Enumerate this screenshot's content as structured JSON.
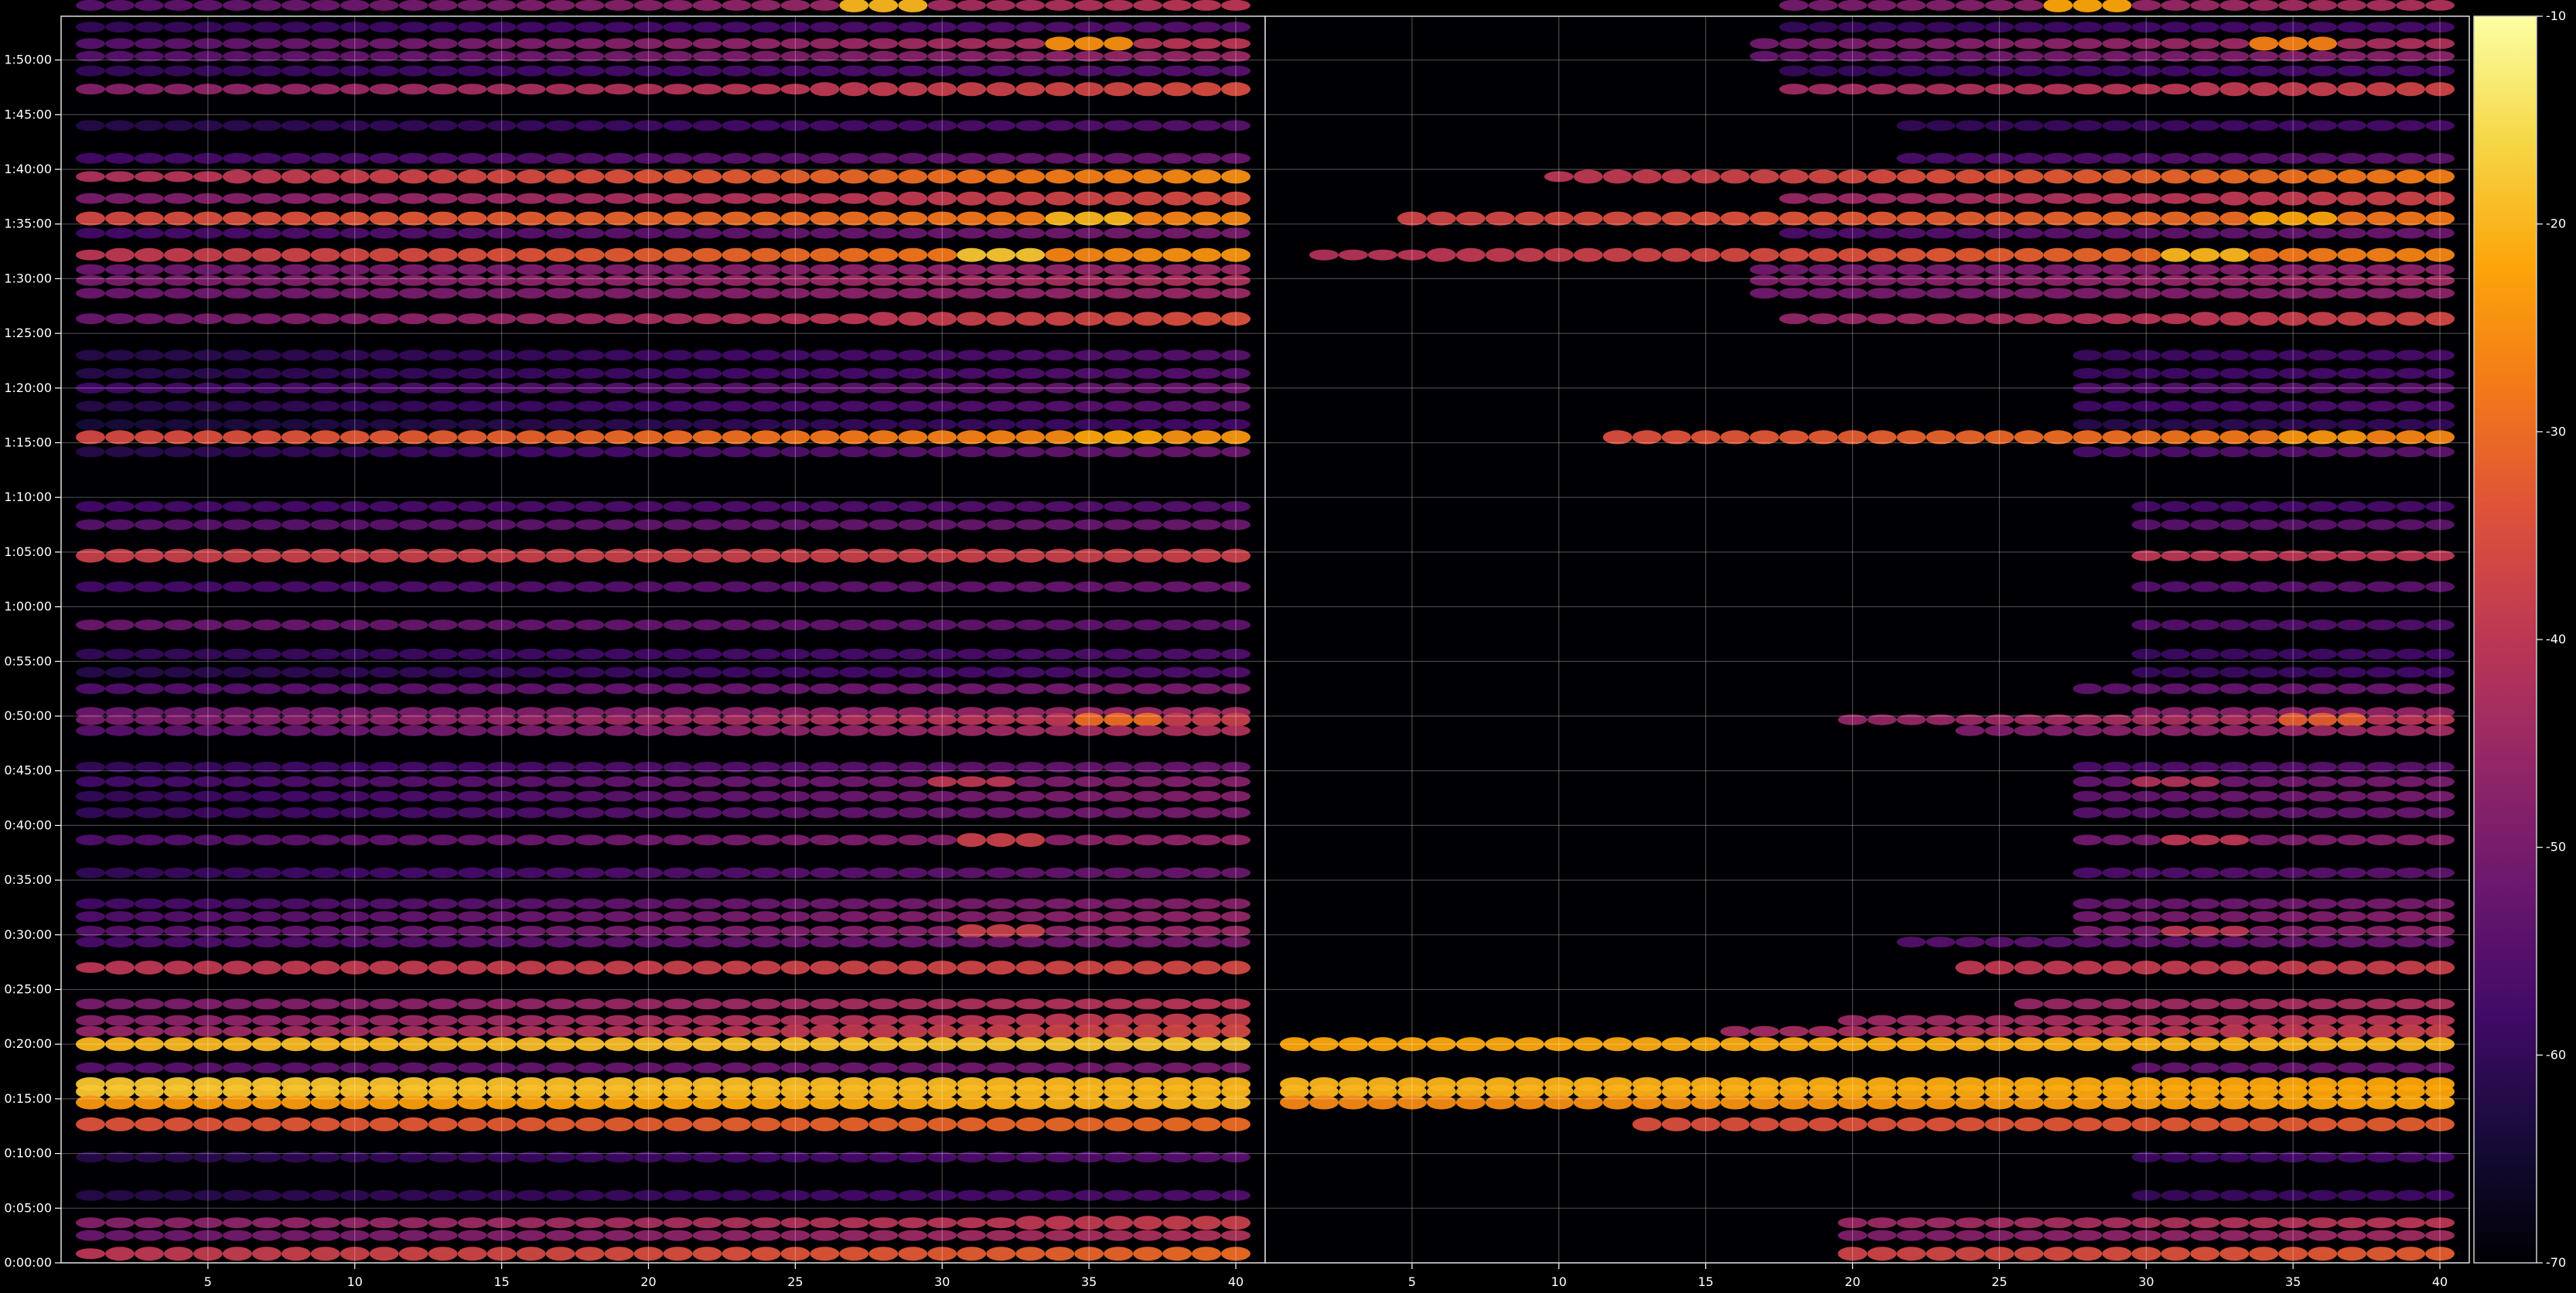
{
  "chart_data": {
    "type": "heatmap",
    "colormap": "inferno",
    "background": "#000000",
    "grid": true,
    "title": "",
    "xlabel": "",
    "ylabel": "",
    "panels": [
      {
        "name": "",
        "xlim": [
          1,
          40
        ],
        "x_ticks": [
          5,
          10,
          15,
          20,
          25,
          30,
          35,
          40
        ],
        "x_tick_labels": [
          "5",
          "10",
          "15",
          "20",
          "25",
          "30",
          "35",
          "40"
        ]
      },
      {
        "name": "",
        "xlim": [
          1,
          40
        ],
        "x_ticks": [
          5,
          10,
          15,
          20,
          25,
          30,
          35,
          40
        ],
        "x_tick_labels": [
          "5",
          "10",
          "15",
          "20",
          "25",
          "30",
          "35",
          "40"
        ]
      }
    ],
    "y_axis": {
      "unit": "seconds",
      "ylim": [
        0,
        6840
      ],
      "ticks": [
        0,
        300,
        600,
        900,
        1200,
        1500,
        1800,
        2100,
        2400,
        2700,
        3000,
        3300,
        3600,
        3900,
        4200,
        4500,
        4800,
        5100,
        5400,
        5700,
        6000,
        6300,
        6600
      ],
      "tick_labels": [
        "0:00:00",
        "0:05:00",
        "0:10:00",
        "0:15:00",
        "0:20:00",
        "0:25:00",
        "0:30:00",
        "0:35:00",
        "0:40:00",
        "0:45:00",
        "0:50:00",
        "0:55:00",
        "1:00:00",
        "1:05:00",
        "1:10:00",
        "1:15:00",
        "1:20:00",
        "1:25:00",
        "1:30:00",
        "1:35:00",
        "1:40:00",
        "1:45:00",
        "1:50:00"
      ]
    },
    "colorbar": {
      "range": [
        -70,
        -10
      ],
      "ticks": [
        -10,
        -20,
        -30,
        -40,
        -50,
        -60,
        -70
      ],
      "tick_labels": [
        "-10",
        "-20",
        "-30",
        "-40",
        "-50",
        "-60",
        "-70"
      ]
    },
    "bands": [
      {
        "y": 6900,
        "v0": -55,
        "v1": -40,
        "peak": -20,
        "peak_x": 28,
        "from_x_right": 18
      },
      {
        "y": 6780,
        "v0": -60,
        "v1": -55,
        "from_x_right": 18
      },
      {
        "y": 6690,
        "v0": -55,
        "v1": -40,
        "peak": -25,
        "peak_x": 35,
        "from_x_right": 17
      },
      {
        "y": 6620,
        "v0": -55,
        "v1": -45,
        "from_x_right": 17
      },
      {
        "y": 6540,
        "v0": -60,
        "v1": -55,
        "from_x_right": 18
      },
      {
        "y": 6440,
        "v0": -48,
        "v1": -35,
        "from_x_right": 18
      },
      {
        "y": 6240,
        "v0": -62,
        "v1": -55,
        "from_x_right": 22
      },
      {
        "y": 6060,
        "v0": -58,
        "v1": -52,
        "from_x_right": 22
      },
      {
        "y": 5960,
        "v0": -42,
        "v1": -25,
        "from_x_right": 10
      },
      {
        "y": 5840,
        "v0": -50,
        "v1": -35,
        "from_x_right": 18
      },
      {
        "y": 5730,
        "v0": -36,
        "v1": -26,
        "peak": -20,
        "peak_x": 35,
        "from_x_right": 5
      },
      {
        "y": 5650,
        "v0": -58,
        "v1": -50,
        "from_x_right": 18
      },
      {
        "y": 5530,
        "v0": -40,
        "v1": -24,
        "peak": -18,
        "peak_x": 32,
        "from_x_right": 2
      },
      {
        "y": 5450,
        "v0": -52,
        "v1": -45,
        "from_x_right": 17
      },
      {
        "y": 5390,
        "v0": -50,
        "v1": -42,
        "from_x_right": 17
      },
      {
        "y": 5320,
        "v0": -52,
        "v1": -45,
        "from_x_right": 17
      },
      {
        "y": 5180,
        "v0": -52,
        "v1": -34,
        "from_x_right": 18
      },
      {
        "y": 4980,
        "v0": -62,
        "v1": -55,
        "from_x_right": 28
      },
      {
        "y": 4880,
        "v0": -62,
        "v1": -55,
        "from_x_right": 28
      },
      {
        "y": 4800,
        "v0": -58,
        "v1": -52,
        "from_x_right": 28
      },
      {
        "y": 4700,
        "v0": -62,
        "v1": -54,
        "from_x_right": 28
      },
      {
        "y": 4600,
        "v0": -64,
        "v1": -58,
        "from_x_right": 28
      },
      {
        "y": 4530,
        "v0": -36,
        "v1": -24,
        "peak": -22,
        "peak_x": 36,
        "from_x_right": 12
      },
      {
        "y": 4450,
        "v0": -62,
        "v1": -52,
        "from_x_right": 28
      },
      {
        "y": 4150,
        "v0": -58,
        "v1": -55,
        "from_x_right": 30
      },
      {
        "y": 4050,
        "v0": -55,
        "v1": -52,
        "from_x_right": 30
      },
      {
        "y": 3880,
        "v0": -38,
        "v1": -38,
        "from_x_right": 30
      },
      {
        "y": 3710,
        "v0": -58,
        "v1": -52,
        "from_x_right": 30
      },
      {
        "y": 3500,
        "v0": -52,
        "v1": -54,
        "from_x_right": 30
      },
      {
        "y": 3340,
        "v0": -60,
        "v1": -56,
        "from_x_right": 30
      },
      {
        "y": 3240,
        "v0": -62,
        "v1": -56,
        "from_x_right": 30
      },
      {
        "y": 3150,
        "v0": -56,
        "v1": -50,
        "from_x_right": 28
      },
      {
        "y": 3020,
        "v0": -52,
        "v1": -44,
        "from_x_right": 30
      },
      {
        "y": 2980,
        "v0": -50,
        "v1": -38,
        "peak": -30,
        "peak_x": 36,
        "from_x_right": 20
      },
      {
        "y": 2920,
        "v0": -55,
        "v1": -42,
        "from_x_right": 24
      },
      {
        "y": 2720,
        "v0": -60,
        "v1": -52,
        "from_x_right": 28
      },
      {
        "y": 2640,
        "v0": -58,
        "v1": -48,
        "peak": -40,
        "peak_x": 31,
        "from_x_right": 28
      },
      {
        "y": 2560,
        "v0": -60,
        "v1": -48,
        "from_x_right": 28
      },
      {
        "y": 2470,
        "v0": -60,
        "v1": -50,
        "from_x_right": 28
      },
      {
        "y": 2320,
        "v0": -56,
        "v1": -46,
        "peak": -38,
        "peak_x": 32,
        "from_x_right": 28
      },
      {
        "y": 2140,
        "v0": -60,
        "v1": -52,
        "from_x_right": 28
      },
      {
        "y": 1970,
        "v0": -58,
        "v1": -48,
        "from_x_right": 28
      },
      {
        "y": 1900,
        "v0": -56,
        "v1": -46,
        "from_x_right": 28
      },
      {
        "y": 1820,
        "v0": -55,
        "v1": -45,
        "peak": -38,
        "peak_x": 32,
        "from_x_right": 28
      },
      {
        "y": 1760,
        "v0": -57,
        "v1": -50,
        "from_x_right": 22
      },
      {
        "y": 1620,
        "v0": -40,
        "v1": -36,
        "from_x_right": 24
      },
      {
        "y": 1420,
        "v0": -50,
        "v1": -40,
        "from_x_right": 26
      },
      {
        "y": 1330,
        "v0": -48,
        "v1": -38,
        "from_x_right": 20
      },
      {
        "y": 1270,
        "v0": -46,
        "v1": -36,
        "from_x_right": 16
      },
      {
        "y": 1200,
        "v0": -20,
        "v1": -18,
        "from_x_right": 1
      },
      {
        "y": 1070,
        "v0": -55,
        "v1": -50,
        "from_x_right": 30
      },
      {
        "y": 980,
        "v0": -18,
        "v1": -20,
        "from_x_right": 1
      },
      {
        "y": 940,
        "v0": -18,
        "v1": -20,
        "from_x_right": 1
      },
      {
        "y": 880,
        "v0": -24,
        "v1": -20,
        "from_x_right": 1
      },
      {
        "y": 760,
        "v0": -34,
        "v1": -30,
        "from_x_right": 13
      },
      {
        "y": 580,
        "v0": -62,
        "v1": -55,
        "from_x_right": 30
      },
      {
        "y": 370,
        "v0": -62,
        "v1": -56,
        "from_x_right": 30
      },
      {
        "y": 220,
        "v0": -48,
        "v1": -38,
        "from_x_right": 20
      },
      {
        "y": 150,
        "v0": -52,
        "v1": -42,
        "from_x_right": 20
      },
      {
        "y": 50,
        "v0": -40,
        "v1": -30,
        "from_x_right": 20
      }
    ]
  }
}
